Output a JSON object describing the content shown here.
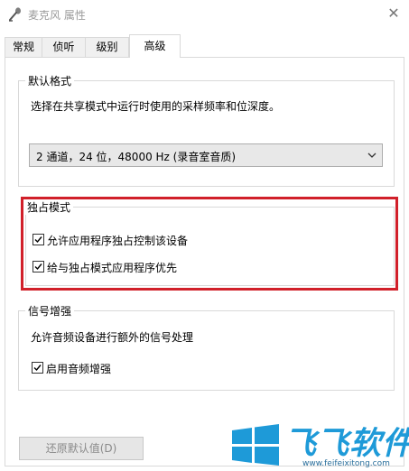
{
  "window": {
    "title": "麦克风 属性"
  },
  "tabs": [
    {
      "label": "常规"
    },
    {
      "label": "侦听"
    },
    {
      "label": "级别"
    },
    {
      "label": "高级"
    }
  ],
  "default_format": {
    "group_label": "默认格式",
    "description": "选择在共享模式中运行时使用的采样频率和位深度。",
    "selected_value": "2 通道，24 位，48000 Hz (录音室音质)"
  },
  "exclusive_mode": {
    "group_label": "独占模式",
    "options": [
      {
        "label": "允许应用程序独占控制该设备",
        "checked": true
      },
      {
        "label": "给与独占模式应用程序优先",
        "checked": true
      }
    ]
  },
  "signal_enhancement": {
    "group_label": "信号增强",
    "description": "允许音频设备进行额外的信号处理",
    "option": {
      "label": "启用音频增强",
      "checked": true
    }
  },
  "buttons": {
    "restore_defaults": "还原默认值(D)"
  },
  "colors": {
    "highlight": "#d1202a",
    "watermark": "#1e9ad8"
  },
  "watermark": {
    "title": "飞飞软件",
    "url": "www.feifeixitong.com"
  }
}
